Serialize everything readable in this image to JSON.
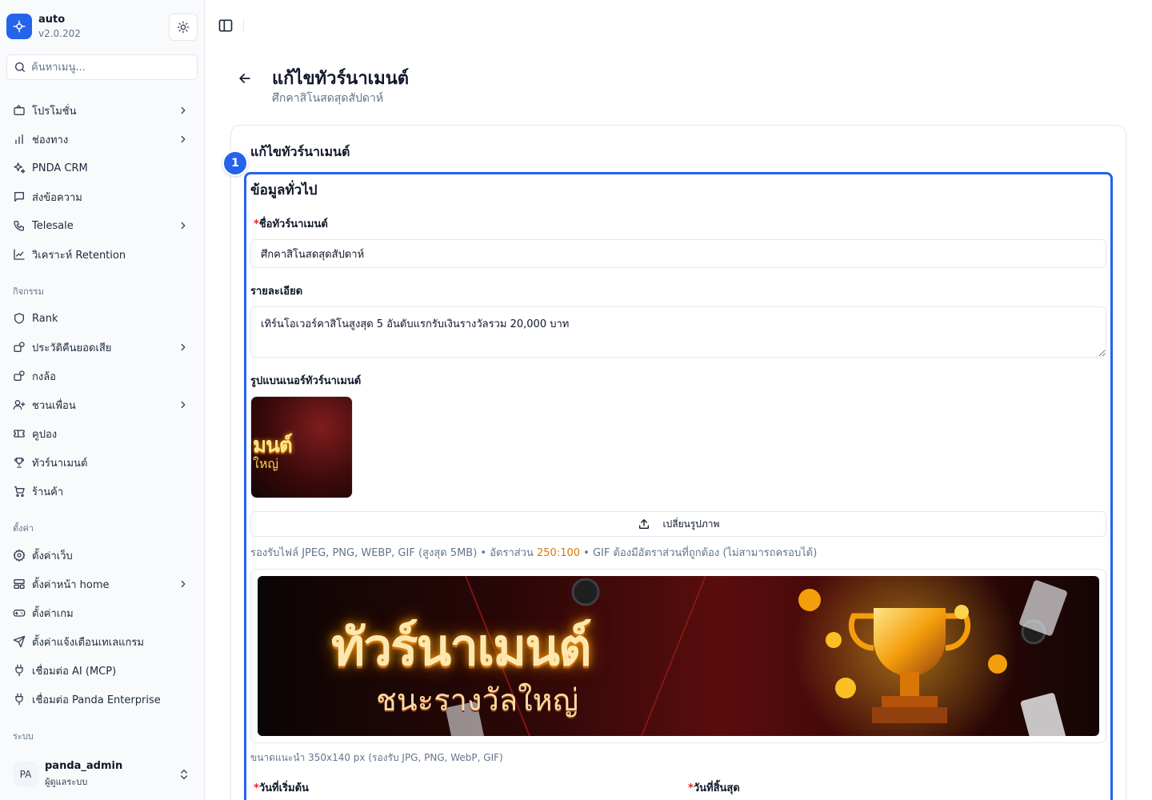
{
  "app": {
    "name": "auto",
    "version": "v2.0.202"
  },
  "search": {
    "placeholder": "ค้นหาเมนู..."
  },
  "sidebar": {
    "items": [
      {
        "label": "โปรโมชั่น",
        "icon": "ticket-icon",
        "has_submenu": true
      },
      {
        "label": "ช่องทาง",
        "icon": "bar-chart-icon",
        "has_submenu": true
      },
      {
        "label": "PNDA CRM",
        "icon": "sparkles-icon",
        "has_submenu": false
      },
      {
        "label": "ส่งข้อความ",
        "icon": "message-square-icon",
        "has_submenu": false
      },
      {
        "label": "Telesale",
        "icon": "phone-icon",
        "has_submenu": true
      },
      {
        "label": "วิเคราะห์ Retention",
        "icon": "line-chart-icon",
        "has_submenu": false
      }
    ],
    "activity_section": "กิจกรรม",
    "activity_items": [
      {
        "label": "Rank",
        "icon": "shield-icon",
        "has_submenu": false
      },
      {
        "label": "ประวัติคืนยอดเสีย",
        "icon": "refund-icon",
        "has_submenu": true
      },
      {
        "label": "กงล้อ",
        "icon": "wheel-icon",
        "has_submenu": false
      },
      {
        "label": "ชวนเพื่อน",
        "icon": "user-plus-icon",
        "has_submenu": true
      },
      {
        "label": "คูปอง",
        "icon": "coupon-icon",
        "has_submenu": false
      },
      {
        "label": "ทัวร์นาเมนต์",
        "icon": "trophy-icon",
        "has_submenu": false
      },
      {
        "label": "ร้านค้า",
        "icon": "cart-icon",
        "has_submenu": false
      }
    ],
    "settings_section": "ตั้งค่า",
    "settings_items": [
      {
        "label": "ตั้งค่าเว็บ",
        "icon": "gear-icon",
        "has_submenu": false
      },
      {
        "label": "ตั้งค่าหน้า home",
        "icon": "layout-icon",
        "has_submenu": true
      },
      {
        "label": "ตั้งค่าเกม",
        "icon": "gamepad-icon",
        "has_submenu": false
      },
      {
        "label": "ตั้งค่าแจ้งเตือนเทเลแกรม",
        "icon": "send-icon",
        "has_submenu": false
      },
      {
        "label": "เชื่อมต่อ AI (MCP)",
        "icon": "plug-icon",
        "has_submenu": false
      },
      {
        "label": "เชื่อมต่อ Panda Enterprise",
        "icon": "plug-icon",
        "has_submenu": false
      }
    ],
    "system_section": "ระบบ"
  },
  "user": {
    "initials": "PA",
    "name": "panda_admin",
    "role": "ผู้ดูแลระบบ"
  },
  "page": {
    "title": "แก้ไขทัวร์นาเมนต์",
    "subtitle": "ศึกคาสิโนสดสุดสัปดาห์"
  },
  "card": {
    "title": "แก้ไขทัวร์นาเมนต์",
    "step": "1",
    "section_title": "ข้อมูลทั่วไป"
  },
  "form": {
    "required_mark": "*",
    "name_label": "ชื่อทัวร์นาเมนต์",
    "name_value": "ศึกคาสิโนสดสุดสัปดาห์",
    "desc_label": "รายละเอียด",
    "desc_value": "เทิร์นโอเวอร์คาสิโนสูงสุด 5 อันดับแรกรับเงินรางวัลรวม 20,000 บาท",
    "banner_label": "รูปแบนเนอร์ทัวร์นาเมนต์",
    "thumb_text_1": "มนต์",
    "thumb_text_2": "ใหญ่",
    "change_image_label": "เปลี่ยนรูปภาพ",
    "file_hint_before": "รองรับไฟล์ JPEG, PNG, WEBP, GIF (สูงสุด 5MB) • อัตราส่วน ",
    "file_hint_ratio": "250:100",
    "file_hint_after": " • GIF ต้องมีอัตราส่วนที่ถูกต้อง (ไม่สามารถครอบได้)",
    "banner_text_1": "ทัวร์นาเมนต์",
    "banner_text_2": "ชนะรางวัลใหญ่",
    "size_hint": "ขนาดแนะนำ 350x140 px (รองรับ JPG, PNG, WebP, GIF)",
    "start_date_label": "วันที่เริ่มต้น",
    "end_date_label": "วันที่สิ้นสุด"
  },
  "colors": {
    "accent": "#2563eb",
    "required": "#dc2626",
    "ratio": "#d97706"
  }
}
